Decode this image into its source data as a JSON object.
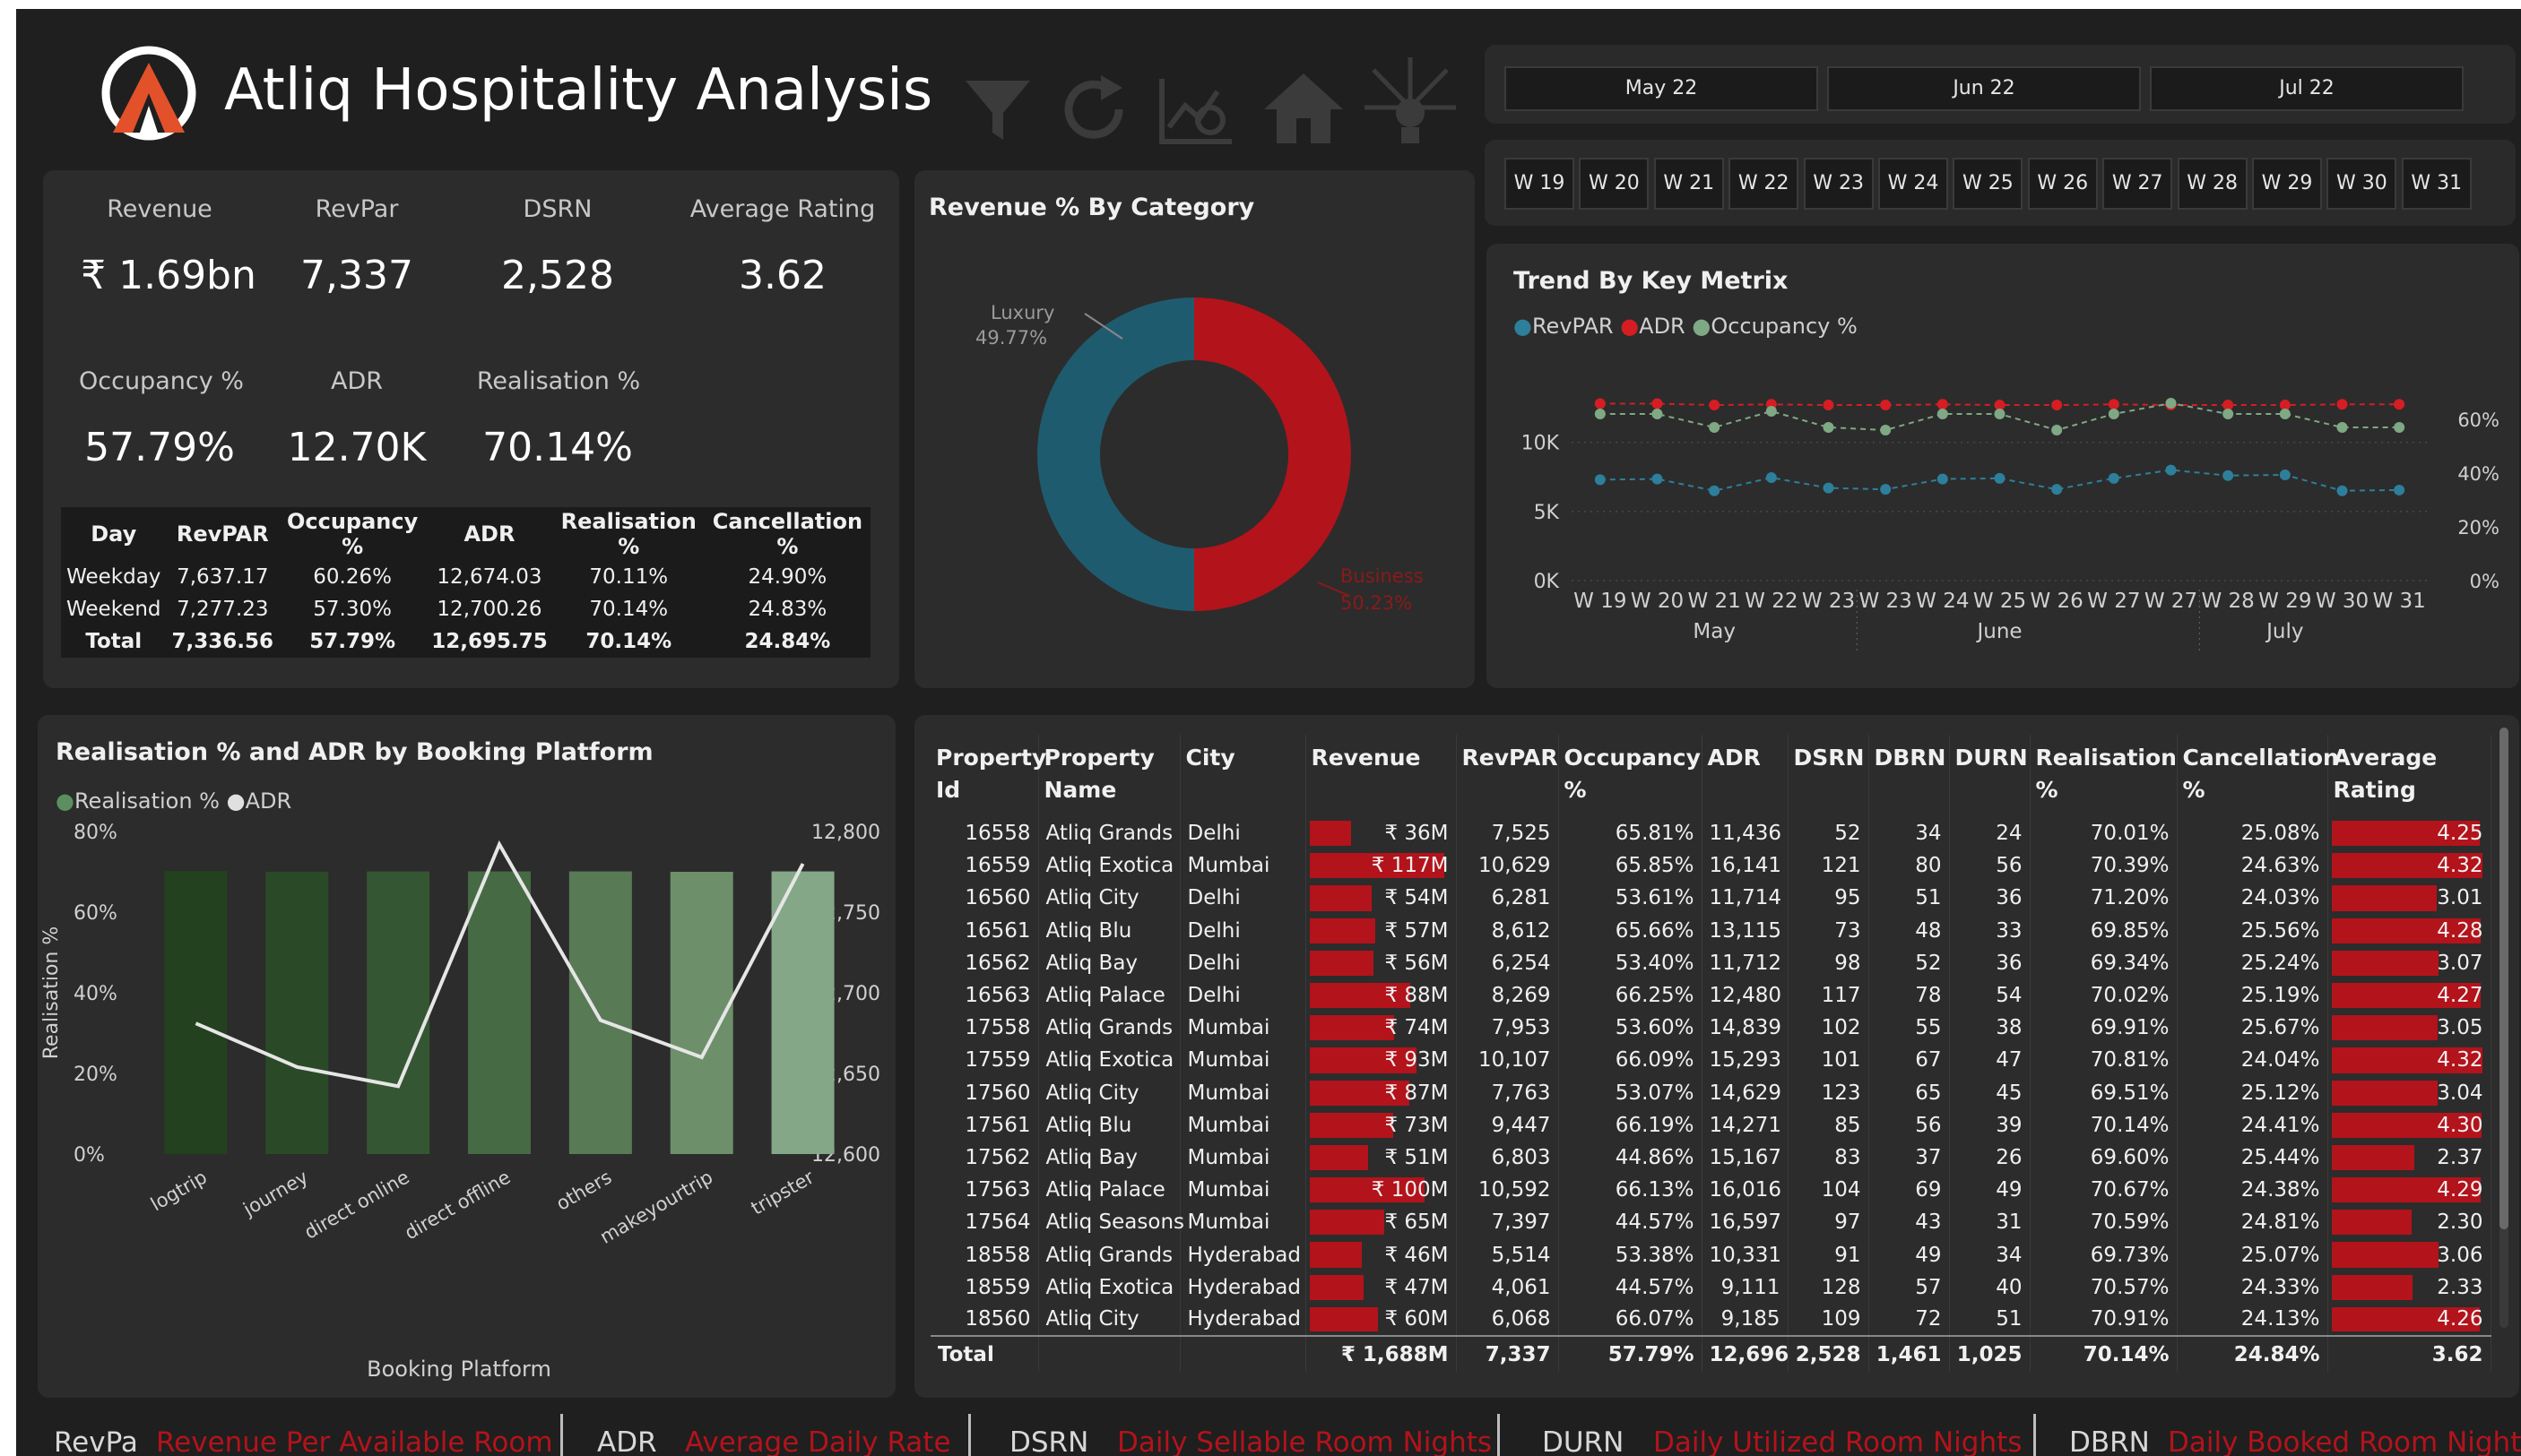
{
  "header": {
    "title": "Atliq Hospitality Analysis"
  },
  "months": [
    "May 22",
    "Jun 22",
    "Jul 22"
  ],
  "weeks": [
    "W 19",
    "W 20",
    "W 21",
    "W 22",
    "W 23",
    "W 24",
    "W 25",
    "W 26",
    "W 27",
    "W 28",
    "W 29",
    "W 30",
    "W 31"
  ],
  "kpis": {
    "row1": [
      {
        "label": "Revenue",
        "value": "₹ 1.69bn"
      },
      {
        "label": "RevPar",
        "value": "7,337"
      },
      {
        "label": "DSRN",
        "value": "2,528"
      },
      {
        "label": "Average Rating",
        "value": "3.62"
      }
    ],
    "row2": [
      {
        "label": "Occupancy %",
        "value": "57.79%"
      },
      {
        "label": "ADR",
        "value": "12.70K"
      },
      {
        "label": "Realisation %",
        "value": "70.14%"
      }
    ]
  },
  "day_table": {
    "headers": [
      "Day",
      "RevPAR",
      "Occupancy %",
      "ADR",
      "Realisation %",
      "Cancellation %"
    ],
    "rows": [
      [
        "Weekday",
        "7,637.17",
        "60.26%",
        "12,674.03",
        "70.11%",
        "24.90%"
      ],
      [
        "Weekend",
        "7,277.23",
        "57.30%",
        "12,700.26",
        "70.14%",
        "24.83%"
      ]
    ],
    "total": [
      "Total",
      "7,336.56",
      "57.79%",
      "12,695.75",
      "70.14%",
      "24.84%"
    ]
  },
  "donut": {
    "title": "Revenue % By Category",
    "labels": {
      "luxury_name": "Luxury",
      "luxury_pct": "49.77%",
      "business_name": "Business",
      "business_pct": "50.23%"
    }
  },
  "trend": {
    "title": "Trend By Key Metrix",
    "legend": [
      "RevPAR",
      "ADR",
      "Occupancy %"
    ],
    "y_left_ticks": [
      "0K",
      "5K",
      "10K"
    ],
    "y_right_ticks": [
      "0%",
      "20%",
      "40%",
      "60%"
    ],
    "x_labels": [
      "W 19",
      "W 20",
      "W 21",
      "W 22",
      "W 23",
      "W 23",
      "W 24",
      "W 25",
      "W 26",
      "W 27",
      "W 27",
      "W 28",
      "W 29",
      "W 30",
      "W 31"
    ],
    "month_labels": [
      "May",
      "June",
      "July"
    ]
  },
  "platform": {
    "title": "Realisation % and ADR by Booking Platform",
    "legend": [
      "Realisation %",
      "ADR"
    ],
    "y_left_ticks": [
      "0%",
      "20%",
      "40%",
      "60%",
      "80%"
    ],
    "y_right_ticks": [
      "12,600",
      "12,650",
      "12,700",
      "12,750",
      "12,800"
    ],
    "ylabel": "Realisation %",
    "xlabel": "Booking Platform"
  },
  "property_table": {
    "headers": [
      "Property Id",
      "Property Name",
      "City",
      "Revenue",
      "RevPAR",
      "Occupancy %",
      "ADR",
      "DSRN",
      "DBRN",
      "DURN",
      "Realisation %",
      "Cancellation %",
      "Average Rating"
    ],
    "rows": [
      [
        "16558",
        "Atliq Grands",
        "Delhi",
        "₹ 36M",
        "7,525",
        "65.81%",
        "11,436",
        "52",
        "34",
        "24",
        "70.01%",
        "25.08%",
        "4.25"
      ],
      [
        "16559",
        "Atliq Exotica",
        "Mumbai",
        "₹ 117M",
        "10,629",
        "65.85%",
        "16,141",
        "121",
        "80",
        "56",
        "70.39%",
        "24.63%",
        "4.32"
      ],
      [
        "16560",
        "Atliq City",
        "Delhi",
        "₹ 54M",
        "6,281",
        "53.61%",
        "11,714",
        "95",
        "51",
        "36",
        "71.20%",
        "24.03%",
        "3.01"
      ],
      [
        "16561",
        "Atliq Blu",
        "Delhi",
        "₹ 57M",
        "8,612",
        "65.66%",
        "13,115",
        "73",
        "48",
        "33",
        "69.85%",
        "25.56%",
        "4.28"
      ],
      [
        "16562",
        "Atliq Bay",
        "Delhi",
        "₹ 56M",
        "6,254",
        "53.40%",
        "11,712",
        "98",
        "52",
        "36",
        "69.34%",
        "25.24%",
        "3.07"
      ],
      [
        "16563",
        "Atliq Palace",
        "Delhi",
        "₹ 88M",
        "8,269",
        "66.25%",
        "12,480",
        "117",
        "78",
        "54",
        "70.02%",
        "25.19%",
        "4.27"
      ],
      [
        "17558",
        "Atliq Grands",
        "Mumbai",
        "₹ 74M",
        "7,953",
        "53.60%",
        "14,839",
        "102",
        "55",
        "38",
        "69.91%",
        "25.67%",
        "3.05"
      ],
      [
        "17559",
        "Atliq Exotica",
        "Mumbai",
        "₹ 93M",
        "10,107",
        "66.09%",
        "15,293",
        "101",
        "67",
        "47",
        "70.81%",
        "24.04%",
        "4.32"
      ],
      [
        "17560",
        "Atliq City",
        "Mumbai",
        "₹ 87M",
        "7,763",
        "53.07%",
        "14,629",
        "123",
        "65",
        "45",
        "69.51%",
        "25.12%",
        "3.04"
      ],
      [
        "17561",
        "Atliq Blu",
        "Mumbai",
        "₹ 73M",
        "9,447",
        "66.19%",
        "14,271",
        "85",
        "56",
        "39",
        "70.14%",
        "24.41%",
        "4.30"
      ],
      [
        "17562",
        "Atliq Bay",
        "Mumbai",
        "₹ 51M",
        "6,803",
        "44.86%",
        "15,167",
        "83",
        "37",
        "26",
        "69.60%",
        "25.44%",
        "2.37"
      ],
      [
        "17563",
        "Atliq Palace",
        "Mumbai",
        "₹ 100M",
        "10,592",
        "66.13%",
        "16,016",
        "104",
        "69",
        "49",
        "70.67%",
        "24.38%",
        "4.29"
      ],
      [
        "17564",
        "Atliq Seasons",
        "Mumbai",
        "₹ 65M",
        "7,397",
        "44.57%",
        "16,597",
        "97",
        "43",
        "31",
        "70.59%",
        "24.81%",
        "2.30"
      ],
      [
        "18558",
        "Atliq Grands",
        "Hyderabad",
        "₹ 46M",
        "5,514",
        "53.38%",
        "10,331",
        "91",
        "49",
        "34",
        "69.73%",
        "25.07%",
        "3.06"
      ],
      [
        "18559",
        "Atliq Exotica",
        "Hyderabad",
        "₹ 47M",
        "4,061",
        "44.57%",
        "9,111",
        "128",
        "57",
        "40",
        "70.57%",
        "24.33%",
        "2.33"
      ],
      [
        "18560",
        "Atliq City",
        "Hyderabad",
        "₹ 60M",
        "6,068",
        "66.07%",
        "9,185",
        "109",
        "72",
        "51",
        "70.91%",
        "24.13%",
        "4.26"
      ]
    ],
    "revenue_millions": [
      36,
      117,
      54,
      57,
      56,
      88,
      74,
      93,
      87,
      73,
      51,
      100,
      65,
      46,
      47,
      60
    ],
    "total": [
      "Total",
      "",
      "",
      "₹ 1,688M",
      "7,337",
      "57.79%",
      "12,696",
      "2,528",
      "1,461",
      "1,025",
      "70.14%",
      "24.84%",
      "3.62"
    ]
  },
  "footer": [
    {
      "key": "RevPa",
      "value": "Revenue Per Available Room"
    },
    {
      "key": "ADR",
      "value": "Average Daily Rate"
    },
    {
      "key": "DSRN",
      "value": "Daily Sellable Room Nights"
    },
    {
      "key": "DURN",
      "value": "Daily Utilized Room Nights"
    },
    {
      "key": "DBRN",
      "value": "Daily Booked Room Nights"
    }
  ],
  "colors": {
    "accent_red": "#b3131b",
    "teal": "#1f5b6e",
    "bar_green_dark": "#23401f",
    "bar_green_light": "#84a887",
    "background": "#1f1f1f",
    "card": "#2c2c2c"
  },
  "chart_data": [
    {
      "type": "pie",
      "title": "Revenue % By Category",
      "categories": [
        "Luxury",
        "Business"
      ],
      "values": [
        49.77,
        50.23
      ]
    },
    {
      "type": "line",
      "title": "Trend By Key Metrix",
      "x": [
        "W 19",
        "W 20",
        "W 21",
        "W 22",
        "W 23",
        "W 23",
        "W 24",
        "W 25",
        "W 26",
        "W 27",
        "W 27",
        "W 28",
        "W 29",
        "W 30",
        "W 31"
      ],
      "series": [
        {
          "name": "RevPAR",
          "axis": "left",
          "values": [
            7300,
            7350,
            6500,
            7450,
            6700,
            6600,
            7350,
            7400,
            6600,
            7400,
            8000,
            7600,
            7650,
            6500,
            6550
          ]
        },
        {
          "name": "ADR",
          "axis": "left",
          "values": [
            12800,
            12800,
            12700,
            12750,
            12700,
            12700,
            12750,
            12700,
            12700,
            12750,
            12700,
            12700,
            12700,
            12750,
            12750
          ]
        },
        {
          "name": "Occupancy %",
          "axis": "right",
          "values": [
            62,
            62,
            57,
            63,
            57,
            56,
            62,
            62,
            56,
            62,
            66,
            62,
            62,
            57,
            57
          ]
        }
      ],
      "ylim_left": [
        0,
        14000
      ],
      "ylim_right": [
        0,
        72
      ],
      "grid": true,
      "legend": "top-left"
    },
    {
      "type": "bar",
      "title": "Realisation % and ADR by Booking Platform",
      "categories": [
        "logtrip",
        "journey",
        "direct online",
        "direct offline",
        "others",
        "makeyourtrip",
        "tripster"
      ],
      "series": [
        {
          "name": "Realisation %",
          "axis": "left",
          "values": [
            70.2,
            70.0,
            70.1,
            70.1,
            70.1,
            70.0,
            70.1
          ]
        },
        {
          "name": "ADR",
          "axis": "right",
          "values": [
            12681,
            12654,
            12642,
            12792,
            12683,
            12660,
            12780
          ]
        }
      ],
      "ylim_left": [
        0,
        80
      ],
      "ylim_right": [
        12600,
        12800
      ],
      "xlabel": "Booking Platform",
      "ylabel": "Realisation %",
      "legend": "top-left"
    }
  ]
}
